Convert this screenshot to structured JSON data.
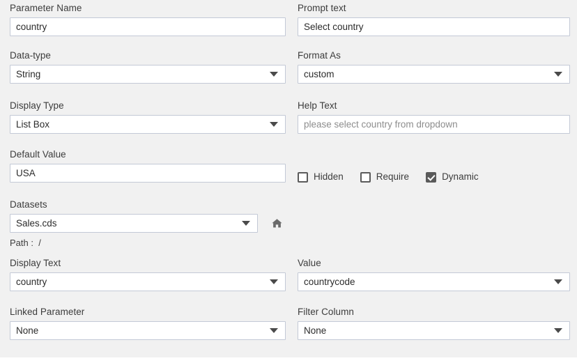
{
  "form": {
    "fields": [
      {
        "label": "Parameter Name",
        "value": "country",
        "type": "text",
        "is_placeholder": false
      },
      {
        "label": "Prompt text",
        "value": "Select country",
        "type": "text",
        "is_placeholder": false
      },
      {
        "label": "Data-type",
        "value": "String",
        "type": "dropdown",
        "is_placeholder": false
      },
      {
        "label": "Format As",
        "value": "custom",
        "type": "dropdown",
        "is_placeholder": false
      },
      {
        "label": "Display Type",
        "value": "List Box",
        "type": "dropdown",
        "is_placeholder": false
      },
      {
        "label": "Help Text",
        "value": "please select country from dropdown",
        "type": "text",
        "is_placeholder": true
      },
      {
        "label": "Default Value",
        "value": "USA",
        "type": "text",
        "is_placeholder": false
      },
      {
        "label": "Datasets",
        "value": "Sales.cds",
        "type": "dropdown",
        "is_placeholder": false
      },
      {
        "label": "Display Text",
        "value": "country",
        "type": "dropdown",
        "is_placeholder": false
      },
      {
        "label": "Value",
        "value": "countrycode",
        "type": "dropdown",
        "is_placeholder": false
      },
      {
        "label": "Linked Parameter",
        "value": "None",
        "type": "dropdown",
        "is_placeholder": false
      },
      {
        "label": "Filter Column",
        "value": "None",
        "type": "dropdown",
        "is_placeholder": false
      }
    ],
    "path_line": "Path :  /",
    "home_icon": "home-icon",
    "checkboxes": [
      {
        "label": "Hidden",
        "checked": false
      },
      {
        "label": "Require",
        "checked": false
      },
      {
        "label": "Dynamic",
        "checked": true
      }
    ]
  },
  "colors": {
    "background": "#f1f1f1",
    "control_background": "#ffffff",
    "control_border": "#c3c9d6",
    "label_text": "#3c3c3c",
    "value_text": "#2b2b2b",
    "placeholder_text": "#8d8d8d",
    "caret": "#4a4a4a",
    "checkbox_checked": "#5a5a5a",
    "icon": "#6b6b6b"
  }
}
